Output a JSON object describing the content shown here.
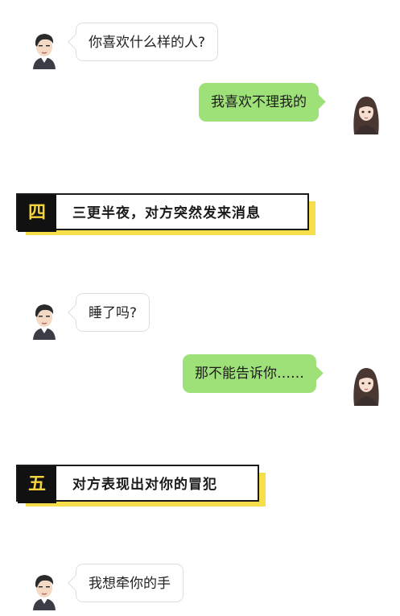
{
  "messages": [
    {
      "side": "left",
      "text": "你喜欢什么样的人?"
    },
    {
      "side": "right",
      "text": "我喜欢不理我的"
    },
    {
      "side": "left",
      "text": "睡了吗?"
    },
    {
      "side": "right",
      "text": "那不能告诉你……"
    },
    {
      "side": "left",
      "text": "我想牵你的手"
    }
  ],
  "sections": [
    {
      "number": "四",
      "title": "三更半夜，对方突然发来消息"
    },
    {
      "number": "五",
      "title": "对方表现出对你的冒犯"
    }
  ],
  "colors": {
    "outgoing_bubble": "#9fe179",
    "incoming_bubble": "#ffffff",
    "section_number_bg": "#111111",
    "section_number_text": "#f5d33d",
    "section_shadow": "#f7df4b"
  },
  "avatars": {
    "male": "male-avatar-icon",
    "female": "female-avatar-icon"
  }
}
